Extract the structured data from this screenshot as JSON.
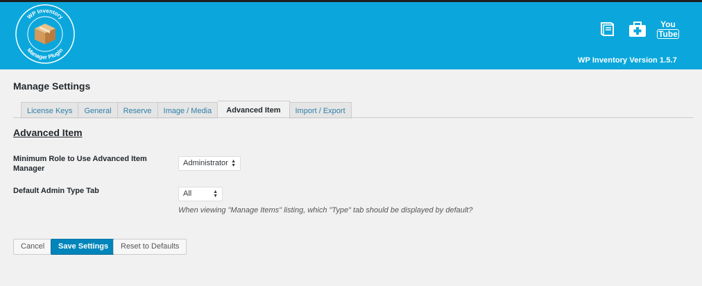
{
  "header": {
    "logo_text": "WP Inventory Manager Plugin",
    "version": "WP Inventory Version 1.5.7",
    "icons": [
      "book-icon",
      "first-aid-kit-icon",
      "youtube-icon"
    ],
    "youtube_label_top": "You",
    "youtube_label_bottom": "Tube",
    "colors": {
      "accent": "#0ba7dc",
      "primary_button": "#0085ba"
    }
  },
  "page": {
    "title": "Manage Settings",
    "tabs": [
      {
        "label": "License Keys",
        "active": false
      },
      {
        "label": "General",
        "active": false
      },
      {
        "label": "Reserve",
        "active": false
      },
      {
        "label": "Image / Media",
        "active": false
      },
      {
        "label": "Advanced Item",
        "active": true
      },
      {
        "label": "Import / Export",
        "active": false
      }
    ],
    "section_title": "Advanced Item"
  },
  "settings": {
    "min_role_label_line1": "Minimum Role to Use Advanced Item",
    "min_role_label_line2": "Manager",
    "min_role_value": "Administrator",
    "default_tab_label": "Default Admin Type Tab",
    "default_tab_value": "All",
    "default_tab_hint": "When viewing \"Manage Items\" listing, which \"Type\" tab should be displayed by default?"
  },
  "buttons": {
    "cancel": "Cancel",
    "save": "Save Settings",
    "reset": "Reset to Defaults"
  }
}
